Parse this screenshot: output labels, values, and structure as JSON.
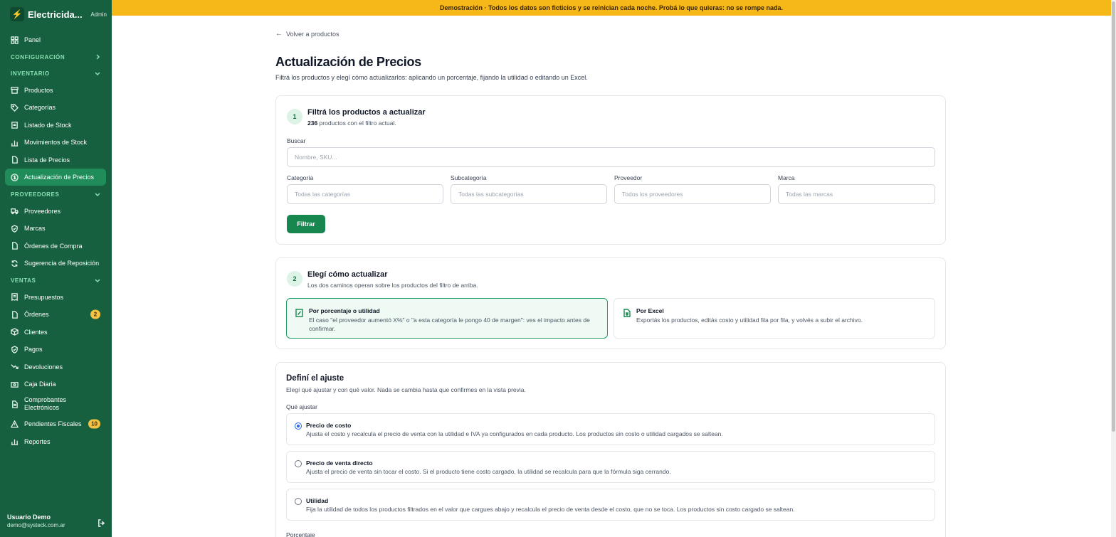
{
  "brand": {
    "name": "Electricida...",
    "role": "Admin"
  },
  "banner": {
    "text": "Demostración · Todos los datos son ficticios y se reinician cada noche. Probá lo que quieras: no se rompe nada."
  },
  "sidebar": {
    "panel": "Panel",
    "sections": {
      "configuracion": "CONFIGURACIÓN",
      "inventario": "INVENTARIO",
      "proveedores": "PROVEEDORES",
      "ventas": "VENTAS"
    },
    "inventario_items": [
      "Productos",
      "Categorías",
      "Listado de Stock",
      "Movimientos de Stock",
      "Lista de Precios",
      "Actualización de Precios"
    ],
    "proveedores_items": [
      "Proveedores",
      "Marcas",
      "Órdenes de Compra",
      "Sugerencia de Reposición"
    ],
    "ventas_items": [
      "Presupuestos",
      "Órdenes",
      "Clientes",
      "Pagos",
      "Devoluciones",
      "Caja Diaria",
      "Comprobantes Electrónicos",
      "Pendientes Fiscales",
      "Reportes"
    ],
    "badges": {
      "ordenes": "2",
      "pendientes": "10"
    }
  },
  "user": {
    "name": "Usuario Demo",
    "email": "demo@systeck.com.ar"
  },
  "page": {
    "back": "Volver a productos",
    "title": "Actualización de Precios",
    "subtitle": "Filtrá los productos y elegí cómo actualizarlos: aplicando un porcentaje, fijando la utilidad o editando un Excel."
  },
  "step1": {
    "number": "1",
    "title": "Filtrá los productos a actualizar",
    "count": "236",
    "count_suffix": " productos con el filtro actual.",
    "search_label": "Buscar",
    "search_placeholder": "Nombre, SKU...",
    "filters": [
      {
        "label": "Categoría",
        "placeholder": "Todas las categorías"
      },
      {
        "label": "Subcategoría",
        "placeholder": "Todas las subcategorías"
      },
      {
        "label": "Proveedor",
        "placeholder": "Todos los proveedores"
      },
      {
        "label": "Marca",
        "placeholder": "Todas las marcas"
      }
    ],
    "filter_button": "Filtrar"
  },
  "step2": {
    "number": "2",
    "title": "Elegí cómo actualizar",
    "subtitle": "Los dos caminos operan sobre los productos del filtro de arriba.",
    "options": [
      {
        "title": "Por porcentaje o utilidad",
        "desc": "El caso \"el proveedor aumentó X%\" o \"a esta categoría le pongo 40 de margen\": ves el impacto antes de confirmar."
      },
      {
        "title": "Por Excel",
        "desc": "Exportás los productos, editás costo y utilidad fila por fila, y volvés a subir el archivo."
      }
    ]
  },
  "adjust": {
    "title": "Definí el ajuste",
    "subtitle": "Elegí qué ajustar y con qué valor. Nada se cambia hasta que confirmes en la vista previa.",
    "what_label": "Qué ajustar",
    "options": [
      {
        "title": "Precio de costo",
        "desc": "Ajusta el costo y recalcula el precio de venta con la utilidad e IVA ya configurados en cada producto. Los productos sin costo o utilidad cargados se saltean."
      },
      {
        "title": "Precio de venta directo",
        "desc": "Ajusta el precio de venta sin tocar el costo. Si el producto tiene costo cargado, la utilidad se recalcula para que la fórmula siga cerrando."
      },
      {
        "title": "Utilidad",
        "desc": "Fija la utilidad de todos los productos filtrados en el valor que cargues abajo y recalcula el precio de venta desde el costo, que no se toca. Los productos sin costo cargado se saltean."
      }
    ],
    "percent_label": "Porcentaje"
  }
}
